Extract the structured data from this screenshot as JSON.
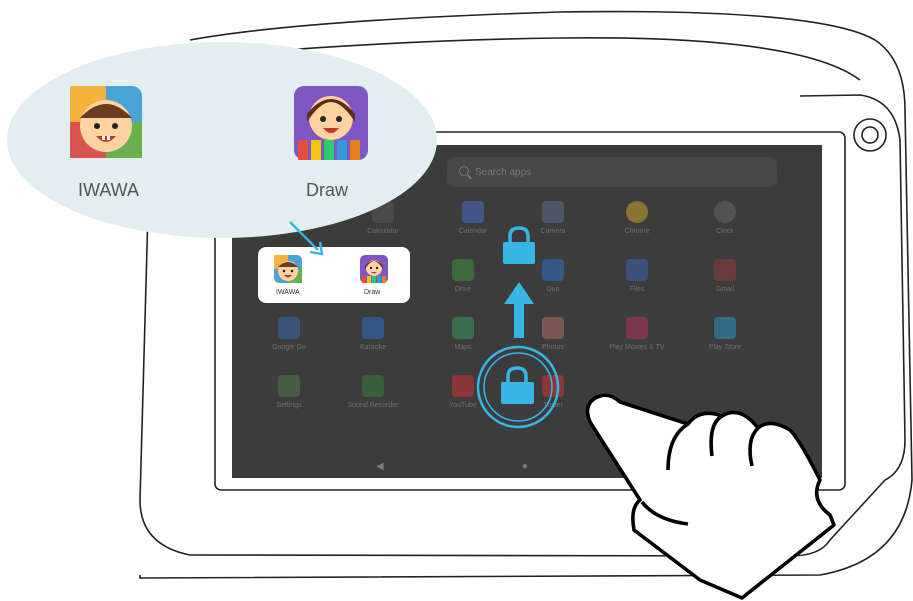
{
  "bubble": {
    "apps": [
      {
        "name": "IWAWA"
      },
      {
        "name": "Draw"
      }
    ]
  },
  "selected_card": {
    "apps": [
      {
        "name": "IWAWA"
      },
      {
        "name": "Draw"
      }
    ]
  },
  "launcher": {
    "search_placeholder": "Search apps",
    "rows": [
      [
        {
          "label": "Calculator",
          "color": "#444"
        },
        {
          "label": "Calendar",
          "color": "#4a6cc9"
        },
        {
          "label": "Camera",
          "color": "#5b6e8a"
        },
        {
          "label": "Chrome",
          "color": "#c9a227"
        },
        {
          "label": "Clock",
          "color": "#555"
        }
      ],
      [
        {
          "label": "Drive",
          "color": "#3b8f3b"
        },
        {
          "label": "Duo",
          "color": "#2f6ec0"
        },
        {
          "label": "Files",
          "color": "#3a66b0"
        },
        {
          "label": "Gmail",
          "color": "#c44"
        }
      ],
      [
        {
          "label": "Google Go",
          "color": "#3a6aa8"
        },
        {
          "label": "Karaoke",
          "color": "#2f6ec0"
        },
        {
          "label": "Maps",
          "color": "#3a8f5a"
        },
        {
          "label": "Photos",
          "color": "#c77"
        },
        {
          "label": "Play Movies & TV",
          "color": "#b0335a"
        },
        {
          "label": "Play Store",
          "color": "#2f8fc0"
        }
      ],
      [
        {
          "label": "Settings",
          "color": "#4f7a4f"
        },
        {
          "label": "Sound Recorder",
          "color": "#3a7a3a"
        },
        {
          "label": "YouTube",
          "color": "#c33"
        },
        {
          "label": "Trailer",
          "color": "#c33"
        }
      ]
    ]
  },
  "colors": {
    "accent": "#37b6e3",
    "bubble": "#e3eef0",
    "screen": "#3c3c3c"
  }
}
